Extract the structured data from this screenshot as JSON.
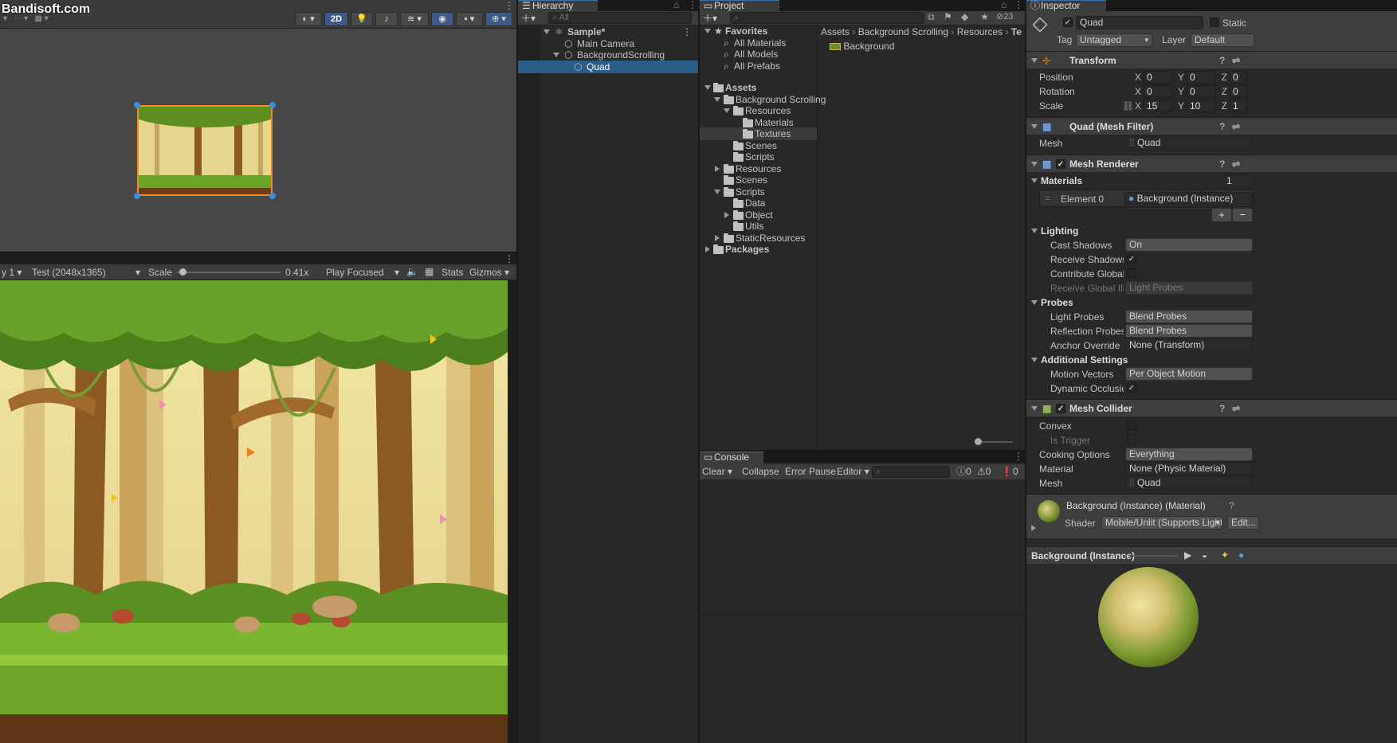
{
  "watermark": "Bandisoft.com",
  "scene_toolbar": {
    "mode_2d": "2D"
  },
  "game_view": {
    "display": "y 1",
    "resolution": "Test (2048x1365)",
    "scale_label": "Scale",
    "scale_value": "0.41x",
    "scale_fraction": 0.05,
    "play_mode": "Play Focused",
    "stats": "Stats",
    "gizmos": "Gizmos"
  },
  "hierarchy": {
    "tab": "Hierarchy",
    "search_placeholder": "All",
    "items": [
      {
        "label": "Sample*",
        "depth": 0,
        "type": "scene",
        "expanded": true
      },
      {
        "label": "Main Camera",
        "depth": 1,
        "type": "object"
      },
      {
        "label": "BackgroundScrolling",
        "depth": 1,
        "type": "object",
        "expanded": true
      },
      {
        "label": "Quad",
        "depth": 2,
        "type": "object",
        "selected": true
      }
    ]
  },
  "project": {
    "tab": "Project",
    "hidden_count": "23",
    "favorites": {
      "label": "Favorites",
      "items": [
        "All Materials",
        "All Models",
        "All Prefabs"
      ]
    },
    "assets_label": "Assets",
    "tree": [
      {
        "label": "Background Scrolling",
        "depth": 1,
        "expanded": true
      },
      {
        "label": "Resources",
        "depth": 2,
        "expanded": true
      },
      {
        "label": "Materials",
        "depth": 3
      },
      {
        "label": "Textures",
        "depth": 3,
        "selected": true
      },
      {
        "label": "Scenes",
        "depth": 2
      },
      {
        "label": "Scripts",
        "depth": 2
      },
      {
        "label": "Resources",
        "depth": 1,
        "collapsed": true
      },
      {
        "label": "Scenes",
        "depth": 1
      },
      {
        "label": "Scripts",
        "depth": 1,
        "expanded": true
      },
      {
        "label": "Data",
        "depth": 2
      },
      {
        "label": "Object",
        "depth": 2,
        "collapsed": true
      },
      {
        "label": "Utils",
        "depth": 2
      },
      {
        "label": "StaticResources",
        "depth": 1,
        "collapsed": true
      }
    ],
    "packages_label": "Packages",
    "breadcrumb": [
      "Assets",
      "Background Scrolling",
      "Resources",
      "Te"
    ],
    "files": [
      "Background"
    ]
  },
  "console": {
    "tab": "Console",
    "clear": "Clear",
    "collapse": "Collapse",
    "error_pause": "Error Pause",
    "editor": "Editor",
    "count_log": "0",
    "count_warn": "0",
    "count_error": "0"
  },
  "inspector": {
    "tab": "Inspector",
    "object_name": "Quad",
    "static_label": "Static",
    "tag_label": "Tag",
    "tag_value": "Untagged",
    "layer_label": "Layer",
    "layer_value": "Default",
    "transform": {
      "title": "Transform",
      "position_label": "Position",
      "position": [
        "0",
        "0",
        "0"
      ],
      "rotation_label": "Rotation",
      "rotation": [
        "0",
        "0",
        "0"
      ],
      "scale_label": "Scale",
      "scale": [
        "15",
        "10",
        "1"
      ]
    },
    "mesh_filter": {
      "title": "Quad (Mesh Filter)",
      "mesh_label": "Mesh",
      "mesh_value": "Quad"
    },
    "mesh_renderer": {
      "title": "Mesh Renderer",
      "materials_label": "Materials",
      "materials_count": "1",
      "element_label": "Element 0",
      "element_value": "Background (Instance)",
      "lighting": "Lighting",
      "cast_shadows_label": "Cast Shadows",
      "cast_shadows": "On",
      "receive_shadows_label": "Receive Shadows",
      "contribute_gi_label": "Contribute Global I",
      "receive_gi_label": "Receive Global Illu",
      "receive_gi": "Light Probes",
      "probes": "Probes",
      "light_probes_label": "Light Probes",
      "light_probes": "Blend Probes",
      "reflection_probes_label": "Reflection Probes",
      "reflection_probes": "Blend Probes",
      "anchor_override_label": "Anchor Override",
      "anchor_override": "None (Transform)",
      "additional": "Additional Settings",
      "motion_vectors_label": "Motion Vectors",
      "motion_vectors": "Per Object Motion",
      "dynamic_occlusion_label": "Dynamic Occlusioı"
    },
    "mesh_collider": {
      "title": "Mesh Collider",
      "convex_label": "Convex",
      "is_trigger_label": "Is Trigger",
      "cooking_label": "Cooking Options",
      "cooking_value": "Everything",
      "material_label": "Material",
      "material_value": "None (Physic Material)",
      "mesh_label": "Mesh",
      "mesh_value": "Quad"
    },
    "material": {
      "title": "Background (Instance) (Material)",
      "shader_label": "Shader",
      "shader_value": "Mobile/Unlit (Supports Light",
      "edit": "Edit..."
    },
    "preview_title": "Background (Instance)"
  }
}
